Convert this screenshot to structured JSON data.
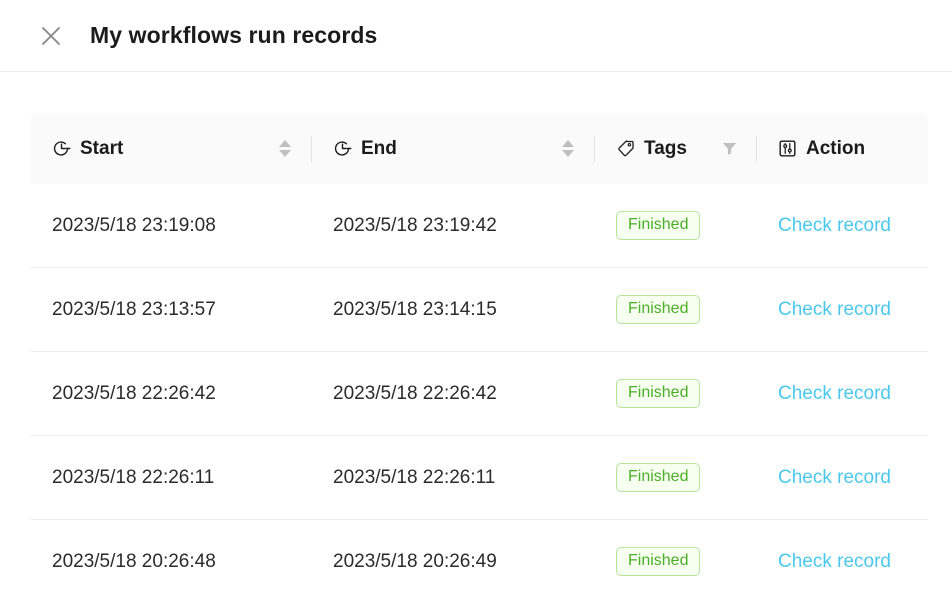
{
  "header": {
    "close_icon": "close-icon",
    "title": "My workflows run records"
  },
  "table": {
    "columns": [
      {
        "key": "start",
        "label": "Start",
        "icon": "clock-start-icon",
        "tool": "sort-control"
      },
      {
        "key": "end",
        "label": "End",
        "icon": "clock-end-icon",
        "tool": "sort-control"
      },
      {
        "key": "tags",
        "label": "Tags",
        "icon": "tag-icon",
        "tool": "filter-icon"
      },
      {
        "key": "action",
        "label": "Action",
        "icon": "sliders-icon",
        "tool": "none"
      }
    ],
    "rows": [
      {
        "start": "2023/5/18 23:19:08",
        "end": "2023/5/18 23:19:42",
        "tag": "Finished",
        "action": "Check record"
      },
      {
        "start": "2023/5/18 23:13:57",
        "end": "2023/5/18 23:14:15",
        "tag": "Finished",
        "action": "Check record"
      },
      {
        "start": "2023/5/18 22:26:42",
        "end": "2023/5/18 22:26:42",
        "tag": "Finished",
        "action": "Check record"
      },
      {
        "start": "2023/5/18 22:26:11",
        "end": "2023/5/18 22:26:11",
        "tag": "Finished",
        "action": "Check record"
      },
      {
        "start": "2023/5/18 20:26:48",
        "end": "2023/5/18 20:26:49",
        "tag": "Finished",
        "action": "Check record"
      }
    ]
  },
  "colors": {
    "link": "#4ac8ee",
    "badge_text": "#4caf28",
    "badge_border": "#b7e39a",
    "badge_bg": "#f6fff0",
    "header_bg": "#fafafa",
    "text": "#1b1b1b"
  }
}
